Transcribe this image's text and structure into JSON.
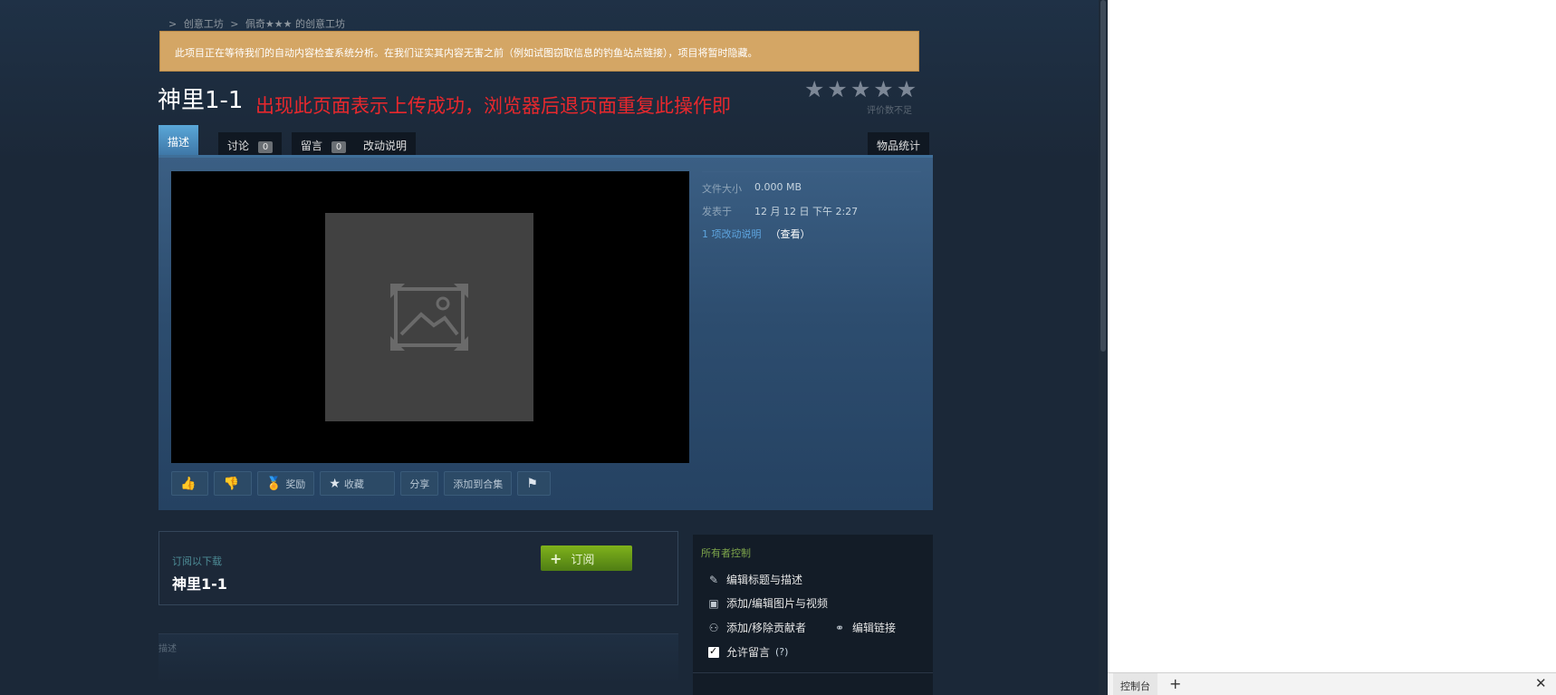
{
  "breadcrumb": {
    "arrow": ">",
    "workshop": "创意工坊",
    "separator": ">",
    "user_workshop": "佩奇★★★ 的创意工坊"
  },
  "notice": {
    "text": "此项目正在等待我们的自动内容检查系统分析。在我们证实其内容无害之前（例如试图窃取信息的钓鱼站点链接），项目将暂时隐藏。"
  },
  "item": {
    "title": "神里1-1",
    "success_message": "出现此页面表示上传成功，浏览器后退页面重复此操作即"
  },
  "rating": {
    "stars": "★★★★★",
    "label": "评价数不足"
  },
  "tabs": {
    "description": "描述",
    "discussions": {
      "label": "讨论",
      "count": "0"
    },
    "comments": {
      "label": "留言",
      "count": "0"
    },
    "changelog": "改动说明",
    "stats": "物品统计"
  },
  "meta": {
    "file_size_key": "文件大小",
    "file_size_value": "0.000 MB",
    "posted_key": "发表于",
    "posted_value": "12 月 12 日 下午 2:27",
    "changes_link": "1 项改动说明",
    "view_link": "（查看）"
  },
  "actions": {
    "thumbs_up_icon": "thumbs-up",
    "award": "奖励",
    "favorite": "收藏",
    "share": "分享",
    "add_to_collection": "添加到合集"
  },
  "subscribe": {
    "label": "订阅以下载",
    "title": "神里1-1",
    "button": "订阅",
    "button_icon": "+"
  },
  "description_section": {
    "label": "描述"
  },
  "owner_controls": {
    "title": "所有者控制",
    "edit_title": "编辑标题与描述",
    "add_media": "添加/编辑图片与视频",
    "contributors": "添加/移除贡献者",
    "edit_links": "编辑链接",
    "allow_comments": "允许留言",
    "help": "(?)"
  },
  "devtools": {
    "tab": "控制台",
    "add": "+",
    "close": "✕"
  },
  "colors": {
    "background": "#1b2838",
    "notice": "#d4a665",
    "accent_blue": "#5ea5df",
    "subscribe_green": "#7fb21b",
    "success_red": "#e8282d"
  }
}
